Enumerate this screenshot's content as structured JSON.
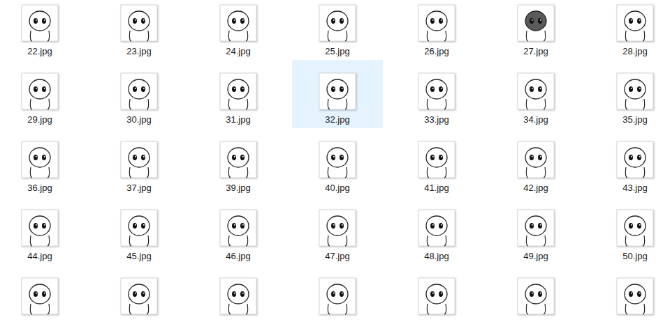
{
  "view": "file-explorer-icons",
  "rows": [
    {
      "items": [
        {
          "label": "22.jpg",
          "selected": false
        },
        {
          "label": "23.jpg",
          "selected": false
        },
        {
          "label": "24.jpg",
          "selected": false
        },
        {
          "label": "25.jpg",
          "selected": false
        },
        {
          "label": "26.jpg",
          "selected": false
        },
        {
          "label": "27.jpg",
          "selected": false
        },
        {
          "label": "28.jpg",
          "selected": false
        }
      ]
    },
    {
      "items": [
        {
          "label": "29.jpg",
          "selected": false
        },
        {
          "label": "30.jpg",
          "selected": false
        },
        {
          "label": "31.jpg",
          "selected": false
        },
        {
          "label": "32.jpg",
          "selected": true
        },
        {
          "label": "33.jpg",
          "selected": false
        },
        {
          "label": "34.jpg",
          "selected": false
        },
        {
          "label": "35.jpg",
          "selected": false
        }
      ]
    },
    {
      "items": [
        {
          "label": "36.jpg",
          "selected": false
        },
        {
          "label": "37.jpg",
          "selected": false
        },
        {
          "label": "39.jpg",
          "selected": false
        },
        {
          "label": "40.jpg",
          "selected": false
        },
        {
          "label": "41.jpg",
          "selected": false
        },
        {
          "label": "42.jpg",
          "selected": false
        },
        {
          "label": "43.jpg",
          "selected": false
        }
      ]
    },
    {
      "items": [
        {
          "label": "44.jpg",
          "selected": false
        },
        {
          "label": "45.jpg",
          "selected": false
        },
        {
          "label": "46.jpg",
          "selected": false
        },
        {
          "label": "47.jpg",
          "selected": false
        },
        {
          "label": "48.jpg",
          "selected": false
        },
        {
          "label": "49.jpg",
          "selected": false
        },
        {
          "label": "50.jpg",
          "selected": false
        }
      ]
    },
    {
      "items": [
        {
          "selected": false
        },
        {
          "selected": false
        },
        {
          "selected": false
        },
        {
          "selected": false
        },
        {
          "selected": false
        },
        {
          "selected": false
        },
        {
          "selected": false
        }
      ]
    }
  ]
}
